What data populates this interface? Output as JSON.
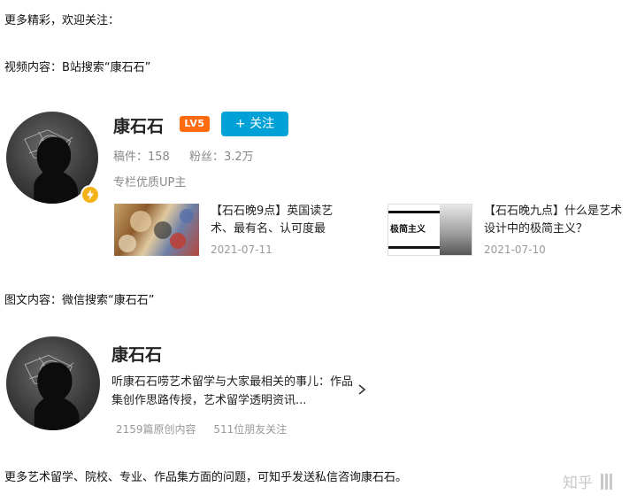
{
  "intro": "更多精彩，欢迎关注：",
  "video_heading": "视频内容：B站搜索“康石石”",
  "bili": {
    "name": "康石石",
    "level": "LV5",
    "follow_label": "+ 关注",
    "manuscripts_label": "稿件：158",
    "fans_label": "粉丝：3.2万",
    "description": "专栏优质UP主",
    "videos": [
      {
        "title": "【石石晚9点】英国读艺术、最有名、认可度最",
        "date": "2021-07-11"
      },
      {
        "title": "【石石晚九点】什么是艺术设计中的极简主义？",
        "date": "2021-07-10",
        "thumb_text": "极简主义"
      }
    ]
  },
  "wechat_heading": "图文内容：微信搜索“康石石”",
  "wechat": {
    "name": "康石石",
    "description": "听康石石唠艺术留学与大家最相关的事儿：作品集创作思路传授，艺术留学透明资讯...",
    "original_count": "2159篇原创内容",
    "friends_following": "511位朋友关注"
  },
  "footer_text": "更多艺术留学、院校、专业、作品集方面的问题，可知乎发送私信咨询康石石。",
  "watermark": "知乎",
  "colors": {
    "bili_blue": "#00a1d6",
    "level_orange": "#ff6a0c",
    "bolt_yellow": "#f5b11a"
  },
  "icons": [
    "lightning-bolt-icon",
    "chevron-right-icon",
    "zhihu-watermark-icon"
  ]
}
